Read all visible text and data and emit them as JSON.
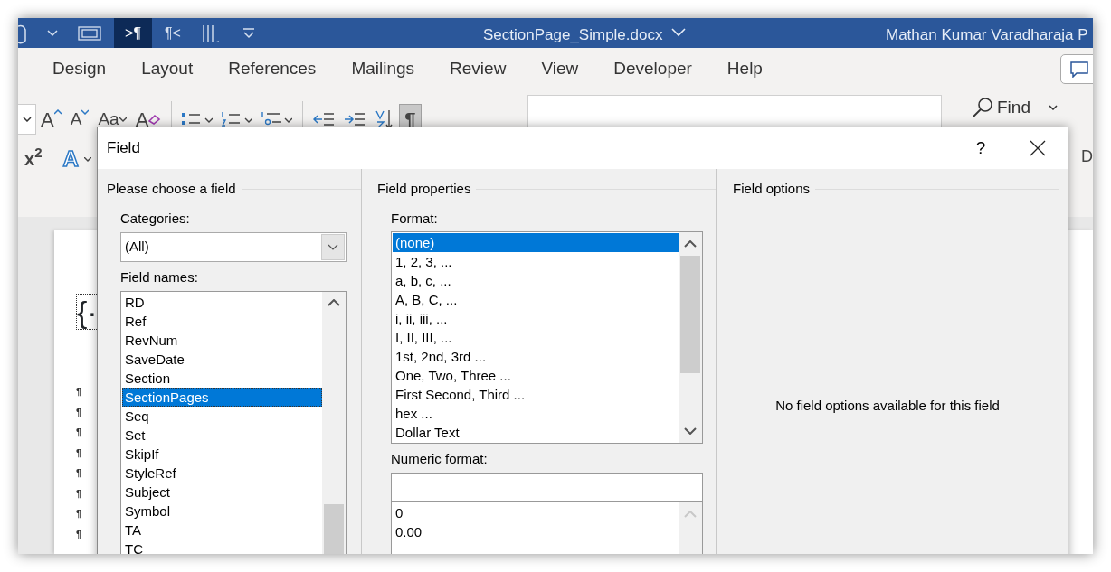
{
  "title_bar": {
    "quick_access": [
      {
        "kind": "touch"
      },
      {
        "kind": "caret"
      },
      {
        "kind": "frame"
      },
      {
        "kind": "text",
        "label": ">¶",
        "on": true
      },
      {
        "kind": "text",
        "label": "¶<",
        "on": false
      },
      {
        "kind": "bracket"
      },
      {
        "kind": "customize"
      }
    ],
    "document_title": "SectionPage_Simple.docx",
    "user_name": "Mathan Kumar Varadharaja P"
  },
  "ribbon_tabs": [
    {
      "label": "Design"
    },
    {
      "label": "Layout"
    },
    {
      "label": "References"
    },
    {
      "label": "Mailings"
    },
    {
      "label": "Review"
    },
    {
      "label": "View"
    },
    {
      "label": "Developer"
    },
    {
      "label": "Help"
    }
  ],
  "ribbon": {
    "row_1": [
      {
        "kind": "caret"
      },
      {
        "kind": "grow",
        "label": "A"
      },
      {
        "kind": "shrink",
        "label": "A"
      },
      {
        "kind": "case",
        "label": "Aa"
      },
      {
        "kind": "clear",
        "label": "A"
      },
      {
        "kind": "sep"
      },
      {
        "kind": "bullets"
      },
      {
        "kind": "numbering"
      },
      {
        "kind": "multilevel"
      },
      {
        "kind": "sep"
      },
      {
        "kind": "outdent"
      },
      {
        "kind": "indent"
      },
      {
        "kind": "sort"
      },
      {
        "kind": "toggle",
        "label": "¶",
        "on": true
      }
    ],
    "find": "Find",
    "row_2": [
      {
        "kind": "rich",
        "label": "x$^{2}$"
      },
      {
        "kind": "effect",
        "label": "A"
      }
    ],
    "edge_text": "D"
  },
  "document": {
    "lines": [
      "{·"
    ],
    "marks": [
      "¶",
      "¶",
      "¶",
      "¶",
      "¶",
      "¶",
      "¶",
      "¶"
    ]
  },
  "dialog": {
    "title": "Field",
    "help": "?",
    "left": {
      "heading": "Please choose a field",
      "categories_label": "Categories:",
      "category": "(All)",
      "names_label": "Field names:",
      "names": [
        {
          "label": "RD",
          "selected": false
        },
        {
          "label": "Ref",
          "selected": false
        },
        {
          "label": "RevNum",
          "selected": false
        },
        {
          "label": "SaveDate",
          "selected": false
        },
        {
          "label": "Section",
          "selected": false
        },
        {
          "label": "SectionPages",
          "selected": true
        },
        {
          "label": "Seq",
          "selected": false
        },
        {
          "label": "Set",
          "selected": false
        },
        {
          "label": "SkipIf",
          "selected": false
        },
        {
          "label": "StyleRef",
          "selected": false
        },
        {
          "label": "Subject",
          "selected": false
        },
        {
          "label": "Symbol",
          "selected": false
        },
        {
          "label": "TA",
          "selected": false
        },
        {
          "label": "TC",
          "selected": false
        }
      ]
    },
    "middle": {
      "heading": "Field properties",
      "format_label": "Format:",
      "formats": [
        {
          "label": "(none)",
          "selected": true
        },
        {
          "label": "1, 2, 3, ...",
          "selected": false
        },
        {
          "label": "a, b, c, ...",
          "selected": false
        },
        {
          "label": "A, B, C, ...",
          "selected": false
        },
        {
          "label": "i, ii, iii, ...",
          "selected": false
        },
        {
          "label": "I, II, III, ...",
          "selected": false
        },
        {
          "label": "1st, 2nd, 3rd ...",
          "selected": false
        },
        {
          "label": "One, Two, Three ...",
          "selected": false
        },
        {
          "label": "First Second, Third ...",
          "selected": false
        },
        {
          "label": "hex ...",
          "selected": false
        },
        {
          "label": "Dollar Text",
          "selected": false
        }
      ],
      "numeric_label": "Numeric format:",
      "numeric_formats": [
        "0",
        "0.00"
      ]
    },
    "right": {
      "heading": "Field options",
      "message": "No field options available for this field"
    }
  }
}
